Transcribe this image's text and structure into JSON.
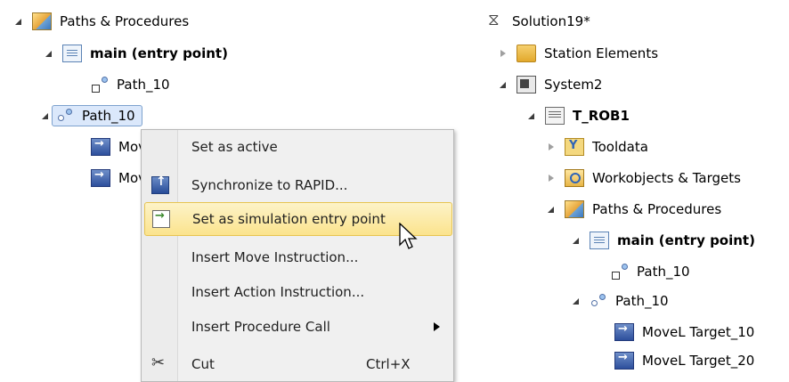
{
  "left_tree": {
    "items": [
      {
        "label": "Paths & Procedures",
        "icon": "paths-procedures-icon",
        "expander": "open"
      },
      {
        "label": "main (entry point)",
        "icon": "procedure-document-icon",
        "expander": "open"
      },
      {
        "label": "Path_10",
        "icon": "path-call-icon"
      },
      {
        "label": "Path_10",
        "icon": "path-icon",
        "expander": "open",
        "selected": true
      },
      {
        "label": "Mov",
        "icon": "move-instruction-icon"
      },
      {
        "label": "Mov",
        "icon": "move-instruction-icon"
      }
    ]
  },
  "context_menu": {
    "items": [
      {
        "label": "Set as active"
      },
      {
        "label": "Synchronize to RAPID...",
        "icon": "synchronize-icon"
      },
      {
        "label": "Set as simulation entry point",
        "icon": "simulation-entry-icon",
        "highlighted": true
      },
      {
        "label": "Insert Move Instruction..."
      },
      {
        "label": "Insert Action Instruction..."
      },
      {
        "label": "Insert Procedure Call",
        "submenu": true
      },
      {
        "label": "Cut",
        "shortcut": "Ctrl+X",
        "icon": "scissors-icon"
      }
    ],
    "highlight_color": "#fbe38d"
  },
  "right_tree": {
    "items": [
      {
        "label": "Solution19*",
        "icon": "solution-icon"
      },
      {
        "label": "Station Elements",
        "icon": "folder-icon",
        "expander": "closed"
      },
      {
        "label": "System2",
        "icon": "system-icon",
        "expander": "open"
      },
      {
        "label": "T_ROB1",
        "icon": "task-icon",
        "expander": "open"
      },
      {
        "label": "Tooldata",
        "icon": "tooldata-icon",
        "expander": "closed"
      },
      {
        "label": "Workobjects & Targets",
        "icon": "workobjects-icon",
        "expander": "closed"
      },
      {
        "label": "Paths & Procedures",
        "icon": "paths-procedures-icon",
        "expander": "open"
      },
      {
        "label": "main (entry point)",
        "icon": "procedure-document-icon",
        "expander": "open"
      },
      {
        "label": "Path_10",
        "icon": "path-call-icon"
      },
      {
        "label": "Path_10",
        "icon": "path-icon",
        "expander": "open"
      },
      {
        "label": "MoveL Target_10",
        "icon": "move-instruction-icon"
      },
      {
        "label": "MoveL Target_20",
        "icon": "move-instruction-icon"
      }
    ]
  }
}
